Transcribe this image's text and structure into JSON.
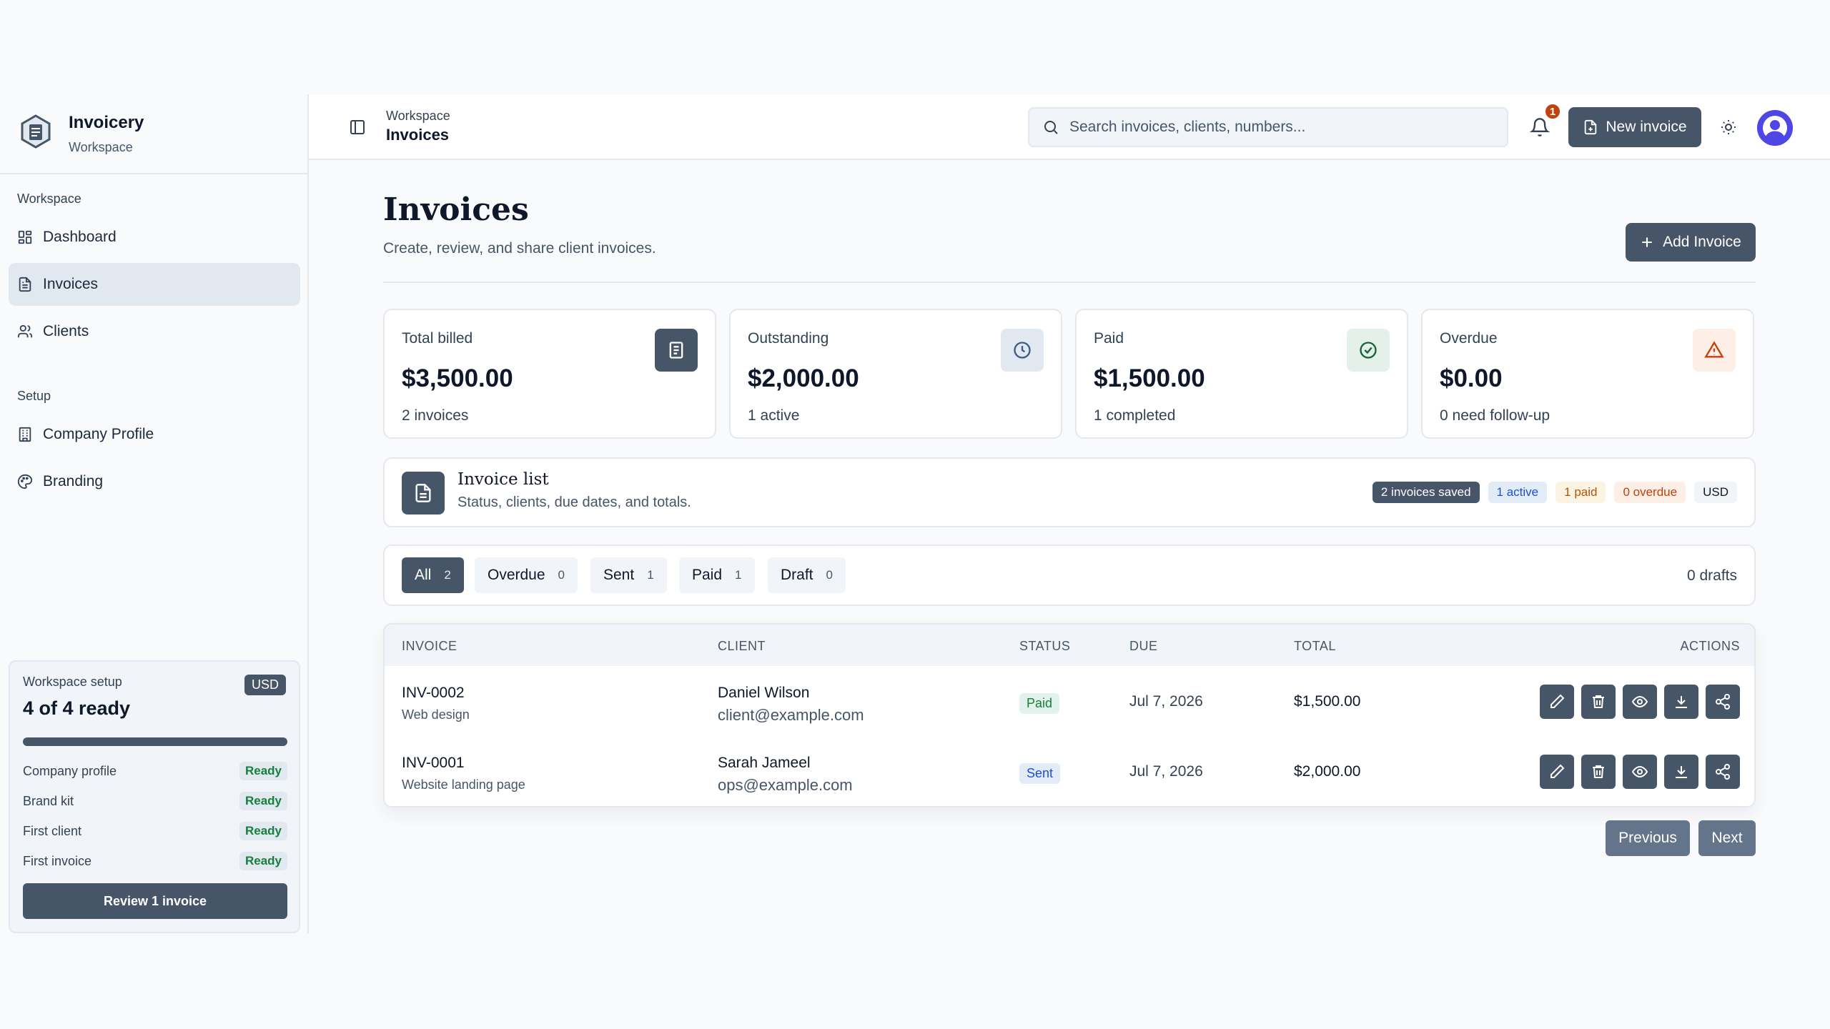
{
  "brand": {
    "name": "Invoicery",
    "sub": "Workspace"
  },
  "sidebar": {
    "sections": [
      {
        "label": "Workspace",
        "items": [
          {
            "label": "Dashboard",
            "icon": "dashboard-icon"
          },
          {
            "label": "Invoices",
            "icon": "document-icon",
            "active": true
          },
          {
            "label": "Clients",
            "icon": "users-icon"
          }
        ]
      },
      {
        "label": "Setup",
        "items": [
          {
            "label": "Company Profile",
            "icon": "building-icon"
          },
          {
            "label": "Branding",
            "icon": "palette-icon"
          }
        ]
      }
    ],
    "setup_card": {
      "label": "Workspace setup",
      "currency": "USD",
      "title": "4 of 4 ready",
      "progress": 1.0,
      "checks": [
        {
          "label": "Company profile",
          "status": "Ready"
        },
        {
          "label": "Brand kit",
          "status": "Ready"
        },
        {
          "label": "First client",
          "status": "Ready"
        },
        {
          "label": "First invoice",
          "status": "Ready"
        }
      ],
      "button": "Review 1 invoice"
    }
  },
  "topbar": {
    "crumb_parent": "Workspace",
    "crumb_current": "Invoices",
    "search_placeholder": "Search invoices, clients, numbers...",
    "notification_count": "1",
    "new_invoice": "New invoice"
  },
  "page": {
    "title": "Invoices",
    "subtitle": "Create, review, and share client invoices.",
    "add_button": "Add Invoice"
  },
  "stats": [
    {
      "label": "Total billed",
      "value": "$3,500.00",
      "note": "2 invoices",
      "icon": "document-icon",
      "icon_bg": "#475569",
      "icon_fg": "#ffffff"
    },
    {
      "label": "Outstanding",
      "value": "$2,000.00",
      "note": "1 active",
      "icon": "clock-icon",
      "icon_bg": "#e2e8f0",
      "icon_fg": "#3b5b8a"
    },
    {
      "label": "Paid",
      "value": "$1,500.00",
      "note": "1 completed",
      "icon": "check-circle-icon",
      "icon_bg": "#e5f0ea",
      "icon_fg": "#166534"
    },
    {
      "label": "Overdue",
      "value": "$0.00",
      "note": "0 need follow-up",
      "icon": "warning-icon",
      "icon_bg": "#fdeee6",
      "icon_fg": "#c2410c"
    }
  ],
  "list": {
    "title": "Invoice list",
    "subtitle": "Status, clients, due dates, and totals.",
    "pills": [
      {
        "label": "2 invoices saved",
        "bg": "#475569",
        "fg": "#ffffff"
      },
      {
        "label": "1 active",
        "bg": "#e2ecf6",
        "fg": "#1d4ed8"
      },
      {
        "label": "1 paid",
        "bg": "#fdf3e3",
        "fg": "#b45309"
      },
      {
        "label": "0 overdue",
        "bg": "#fdeee6",
        "fg": "#c2410c"
      },
      {
        "label": "USD",
        "bg": "#f1f5f9",
        "fg": "#0f172a"
      }
    ]
  },
  "tabs": [
    {
      "label": "All",
      "count": "2",
      "active": true
    },
    {
      "label": "Overdue",
      "count": "0"
    },
    {
      "label": "Sent",
      "count": "1"
    },
    {
      "label": "Paid",
      "count": "1"
    },
    {
      "label": "Draft",
      "count": "0"
    }
  ],
  "drafts": "0 drafts",
  "table": {
    "headers": {
      "invoice": "INVOICE",
      "client": "CLIENT",
      "status": "STATUS",
      "due": "DUE",
      "total": "TOTAL",
      "actions": "ACTIONS"
    },
    "rows": [
      {
        "id": "INV-0002",
        "desc": "Web design",
        "client": "Daniel Wilson",
        "email": "client@example.com",
        "status": "Paid",
        "due": "Jul 7, 2026",
        "total": "$1,500.00"
      },
      {
        "id": "INV-0001",
        "desc": "Website landing page",
        "client": "Sarah Jameel",
        "email": "ops@example.com",
        "status": "Sent",
        "due": "Jul 7, 2026",
        "total": "$2,000.00"
      }
    ]
  },
  "pagination": {
    "previous": "Previous",
    "next": "Next"
  }
}
